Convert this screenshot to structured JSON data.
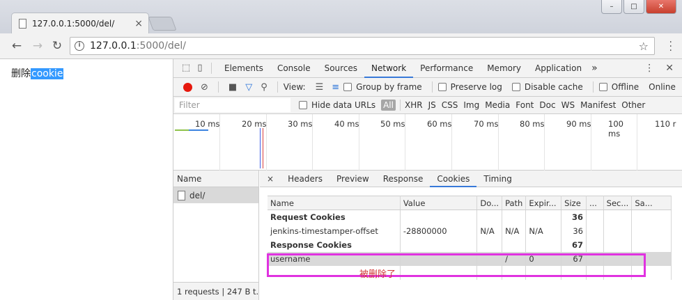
{
  "browser": {
    "tab_title": "127.0.0.1:5000/del/",
    "tab_close": "×",
    "url_host": "127.0.0.1",
    "url_path": ":5000/del/",
    "back": "←",
    "forward": "→",
    "reload": "↻",
    "star": "☆"
  },
  "window_buttons": {
    "minimize": "–",
    "maximize": "□",
    "close": "✕"
  },
  "page": {
    "text_prefix": "删除",
    "text_selected": "cookie"
  },
  "devtools": {
    "tabs": [
      "Elements",
      "Console",
      "Sources",
      "Network",
      "Performance",
      "Memory",
      "Application"
    ],
    "active_tab": "Network",
    "more": "»",
    "toolbar": {
      "view_label": "View:",
      "group_by_frame": "Group by frame",
      "preserve_log": "Preserve log",
      "disable_cache": "Disable cache",
      "offline": "Offline",
      "online": "Online"
    },
    "filter": {
      "placeholder": "Filter",
      "hide_data_urls": "Hide data URLs",
      "all": "All",
      "types": [
        "XHR",
        "JS",
        "CSS",
        "Img",
        "Media",
        "Font",
        "Doc",
        "WS",
        "Manifest",
        "Other"
      ]
    },
    "timeline_ticks": [
      "10 ms",
      "20 ms",
      "30 ms",
      "40 ms",
      "50 ms",
      "60 ms",
      "70 ms",
      "80 ms",
      "90 ms",
      "100 ms",
      "110 r"
    ],
    "names": {
      "header": "Name",
      "rows": [
        "del/"
      ],
      "footer": "1 requests | 247 B t..."
    },
    "detail_tabs": [
      "Headers",
      "Preview",
      "Response",
      "Cookies",
      "Timing"
    ],
    "detail_active": "Cookies",
    "detail_close": "×",
    "cookies": {
      "columns": [
        "Name",
        "Value",
        "Do...",
        "Path",
        "Expir...",
        "Size",
        "...",
        "Sec...",
        "Sa..."
      ],
      "request_group": "Request Cookies",
      "request_size": "36",
      "request_row": {
        "name": "jenkins-timestamper-offset",
        "value": "-28800000",
        "domain": "N/A",
        "path": "N/A",
        "expires": "N/A",
        "size": "36"
      },
      "response_group": "Response Cookies",
      "response_size": "67",
      "response_row": {
        "name": "username",
        "value": "",
        "domain": "",
        "path": "/",
        "expires": "0",
        "size": "67"
      }
    }
  },
  "annotation": {
    "text": "被删除了",
    "color": "#e032e0"
  },
  "colors": {
    "accent": "#3879d9",
    "record": "#e6180d",
    "selection": "#3399ff"
  }
}
